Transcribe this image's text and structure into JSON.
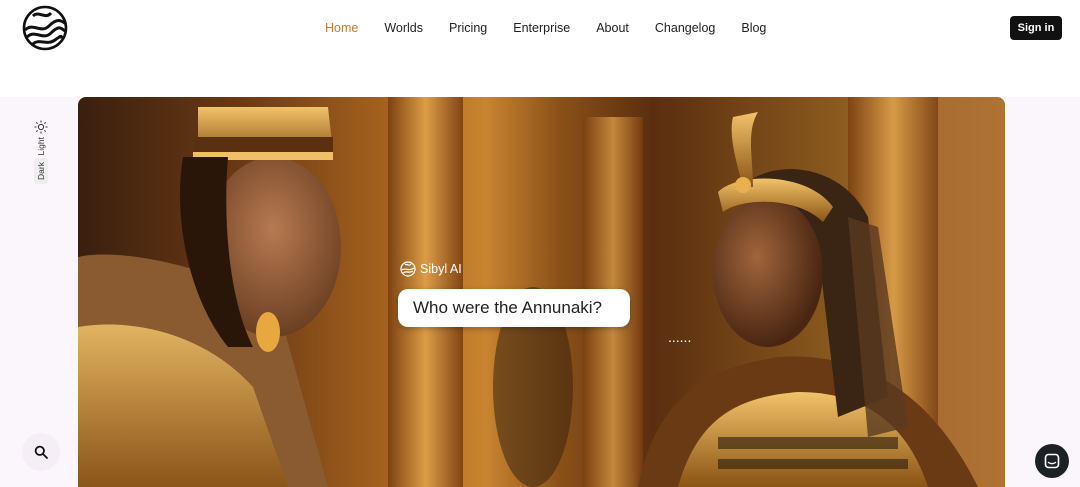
{
  "header": {
    "logo_icon": "wave-globe-logo",
    "nav": [
      {
        "label": "Home",
        "active": true
      },
      {
        "label": "Worlds",
        "active": false
      },
      {
        "label": "Pricing",
        "active": false
      },
      {
        "label": "Enterprise",
        "active": false
      },
      {
        "label": "About",
        "active": false
      },
      {
        "label": "Changelog",
        "active": false
      },
      {
        "label": "Blog",
        "active": false
      }
    ],
    "signin_label": "Sign in"
  },
  "theme": {
    "light_label": "Light",
    "dark_label": "Dark"
  },
  "hero": {
    "brand_label": "Sibyl AI",
    "question": "Who were the Annunaki?",
    "typing_indicator": "......"
  },
  "colors": {
    "accent": "#c77a3a",
    "signin_bg": "#111111",
    "band_bg": "#fbf6fb",
    "launcher_bg": "#1c2126"
  }
}
